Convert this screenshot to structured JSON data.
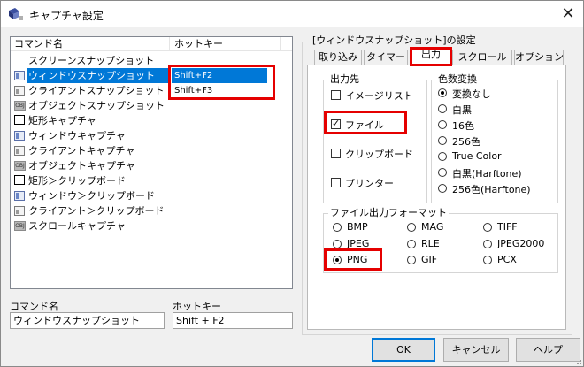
{
  "window": {
    "title": "キャプチャ設定",
    "close_glyph": "✕"
  },
  "list": {
    "headers": {
      "name": "コマンド名",
      "hotkey": "ホットキー"
    },
    "rows": [
      {
        "name": "スクリーンスナップショット",
        "hotkey": "",
        "icon": "none"
      },
      {
        "name": "ウィンドウスナップショット",
        "hotkey": "Shift+F2",
        "icon": "window-icon",
        "selected": true
      },
      {
        "name": "クライアントスナップショット",
        "hotkey": "Shift+F3",
        "icon": "client-icon"
      },
      {
        "name": "オブジェクトスナップショット",
        "hotkey": "",
        "icon": "object-icon"
      },
      {
        "name": "矩形キャプチャ",
        "hotkey": "",
        "icon": "rectangle-icon"
      },
      {
        "name": "ウィンドウキャプチャ",
        "hotkey": "",
        "icon": "window-icon"
      },
      {
        "name": "クライアントキャプチャ",
        "hotkey": "",
        "icon": "client-icon"
      },
      {
        "name": "オブジェクトキャプチャ",
        "hotkey": "",
        "icon": "object-icon"
      },
      {
        "name": "矩形＞クリップボード",
        "hotkey": "",
        "icon": "rectangle-icon"
      },
      {
        "name": "ウィンドウ＞クリップボード",
        "hotkey": "",
        "icon": "window-icon"
      },
      {
        "name": "クライアント＞クリップボード",
        "hotkey": "",
        "icon": "client-icon"
      },
      {
        "name": "スクロールキャプチャ",
        "hotkey": "",
        "icon": "object-icon"
      }
    ],
    "object_icon_text": "OBJ"
  },
  "bottom_fields": {
    "command_label": "コマンド名",
    "command_value": "ウィンドウスナップショット",
    "hotkey_label": "ホットキー",
    "hotkey_value": "Shift + F2"
  },
  "settings": {
    "group_title": "[ウィンドウスナップショット]の設定",
    "tabs": [
      {
        "label": "取り込み"
      },
      {
        "label": "タイマー"
      },
      {
        "label": "出力",
        "active": true
      },
      {
        "label": "スクロール"
      },
      {
        "label": "オプション"
      }
    ],
    "output_dest": {
      "title": "出力先",
      "items": [
        {
          "label": "イメージリスト",
          "checked": false
        },
        {
          "label": "ファイル",
          "checked": true
        },
        {
          "label": "クリップボード",
          "checked": false
        },
        {
          "label": "プリンター",
          "checked": false
        }
      ]
    },
    "color_conv": {
      "title": "色数変換",
      "items": [
        {
          "label": "変換なし",
          "selected": true
        },
        {
          "label": "白黒",
          "selected": false
        },
        {
          "label": "16色",
          "selected": false
        },
        {
          "label": "256色",
          "selected": false
        },
        {
          "label": "True Color",
          "selected": false
        },
        {
          "label": "白黒(Harftone)",
          "selected": false
        },
        {
          "label": "256色(Harftone)",
          "selected": false
        }
      ]
    },
    "file_format": {
      "title": "ファイル出力フォーマット",
      "items": [
        {
          "label": "BMP",
          "selected": false
        },
        {
          "label": "MAG",
          "selected": false
        },
        {
          "label": "TIFF",
          "selected": false
        },
        {
          "label": "JPEG",
          "selected": false
        },
        {
          "label": "RLE",
          "selected": false
        },
        {
          "label": "JPEG2000",
          "selected": false
        },
        {
          "label": "PNG",
          "selected": true
        },
        {
          "label": "GIF",
          "selected": false
        },
        {
          "label": "PCX",
          "selected": false
        }
      ]
    }
  },
  "buttons": {
    "ok": "OK",
    "cancel": "キャンセル",
    "help": "ヘルプ"
  },
  "colors": {
    "selection": "#0078d7",
    "highlight_box": "#e50000"
  }
}
